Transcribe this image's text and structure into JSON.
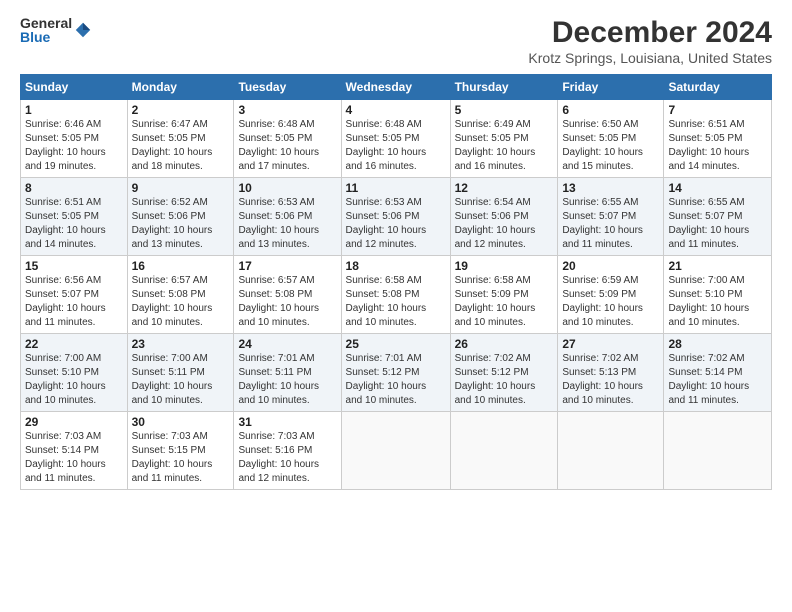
{
  "logo": {
    "general": "General",
    "blue": "Blue"
  },
  "title": "December 2024",
  "subtitle": "Krotz Springs, Louisiana, United States",
  "headers": [
    "Sunday",
    "Monday",
    "Tuesday",
    "Wednesday",
    "Thursday",
    "Friday",
    "Saturday"
  ],
  "weeks": [
    [
      {
        "day": "1",
        "sunrise": "6:46 AM",
        "sunset": "5:05 PM",
        "daylight": "10 hours and 19 minutes."
      },
      {
        "day": "2",
        "sunrise": "6:47 AM",
        "sunset": "5:05 PM",
        "daylight": "10 hours and 18 minutes."
      },
      {
        "day": "3",
        "sunrise": "6:48 AM",
        "sunset": "5:05 PM",
        "daylight": "10 hours and 17 minutes."
      },
      {
        "day": "4",
        "sunrise": "6:48 AM",
        "sunset": "5:05 PM",
        "daylight": "10 hours and 16 minutes."
      },
      {
        "day": "5",
        "sunrise": "6:49 AM",
        "sunset": "5:05 PM",
        "daylight": "10 hours and 16 minutes."
      },
      {
        "day": "6",
        "sunrise": "6:50 AM",
        "sunset": "5:05 PM",
        "daylight": "10 hours and 15 minutes."
      },
      {
        "day": "7",
        "sunrise": "6:51 AM",
        "sunset": "5:05 PM",
        "daylight": "10 hours and 14 minutes."
      }
    ],
    [
      {
        "day": "8",
        "sunrise": "6:51 AM",
        "sunset": "5:05 PM",
        "daylight": "10 hours and 14 minutes."
      },
      {
        "day": "9",
        "sunrise": "6:52 AM",
        "sunset": "5:06 PM",
        "daylight": "10 hours and 13 minutes."
      },
      {
        "day": "10",
        "sunrise": "6:53 AM",
        "sunset": "5:06 PM",
        "daylight": "10 hours and 13 minutes."
      },
      {
        "day": "11",
        "sunrise": "6:53 AM",
        "sunset": "5:06 PM",
        "daylight": "10 hours and 12 minutes."
      },
      {
        "day": "12",
        "sunrise": "6:54 AM",
        "sunset": "5:06 PM",
        "daylight": "10 hours and 12 minutes."
      },
      {
        "day": "13",
        "sunrise": "6:55 AM",
        "sunset": "5:07 PM",
        "daylight": "10 hours and 11 minutes."
      },
      {
        "day": "14",
        "sunrise": "6:55 AM",
        "sunset": "5:07 PM",
        "daylight": "10 hours and 11 minutes."
      }
    ],
    [
      {
        "day": "15",
        "sunrise": "6:56 AM",
        "sunset": "5:07 PM",
        "daylight": "10 hours and 11 minutes."
      },
      {
        "day": "16",
        "sunrise": "6:57 AM",
        "sunset": "5:08 PM",
        "daylight": "10 hours and 10 minutes."
      },
      {
        "day": "17",
        "sunrise": "6:57 AM",
        "sunset": "5:08 PM",
        "daylight": "10 hours and 10 minutes."
      },
      {
        "day": "18",
        "sunrise": "6:58 AM",
        "sunset": "5:08 PM",
        "daylight": "10 hours and 10 minutes."
      },
      {
        "day": "19",
        "sunrise": "6:58 AM",
        "sunset": "5:09 PM",
        "daylight": "10 hours and 10 minutes."
      },
      {
        "day": "20",
        "sunrise": "6:59 AM",
        "sunset": "5:09 PM",
        "daylight": "10 hours and 10 minutes."
      },
      {
        "day": "21",
        "sunrise": "7:00 AM",
        "sunset": "5:10 PM",
        "daylight": "10 hours and 10 minutes."
      }
    ],
    [
      {
        "day": "22",
        "sunrise": "7:00 AM",
        "sunset": "5:10 PM",
        "daylight": "10 hours and 10 minutes."
      },
      {
        "day": "23",
        "sunrise": "7:00 AM",
        "sunset": "5:11 PM",
        "daylight": "10 hours and 10 minutes."
      },
      {
        "day": "24",
        "sunrise": "7:01 AM",
        "sunset": "5:11 PM",
        "daylight": "10 hours and 10 minutes."
      },
      {
        "day": "25",
        "sunrise": "7:01 AM",
        "sunset": "5:12 PM",
        "daylight": "10 hours and 10 minutes."
      },
      {
        "day": "26",
        "sunrise": "7:02 AM",
        "sunset": "5:12 PM",
        "daylight": "10 hours and 10 minutes."
      },
      {
        "day": "27",
        "sunrise": "7:02 AM",
        "sunset": "5:13 PM",
        "daylight": "10 hours and 10 minutes."
      },
      {
        "day": "28",
        "sunrise": "7:02 AM",
        "sunset": "5:14 PM",
        "daylight": "10 hours and 11 minutes."
      }
    ],
    [
      {
        "day": "29",
        "sunrise": "7:03 AM",
        "sunset": "5:14 PM",
        "daylight": "10 hours and 11 minutes."
      },
      {
        "day": "30",
        "sunrise": "7:03 AM",
        "sunset": "5:15 PM",
        "daylight": "10 hours and 11 minutes."
      },
      {
        "day": "31",
        "sunrise": "7:03 AM",
        "sunset": "5:16 PM",
        "daylight": "10 hours and 12 minutes."
      },
      null,
      null,
      null,
      null
    ]
  ]
}
